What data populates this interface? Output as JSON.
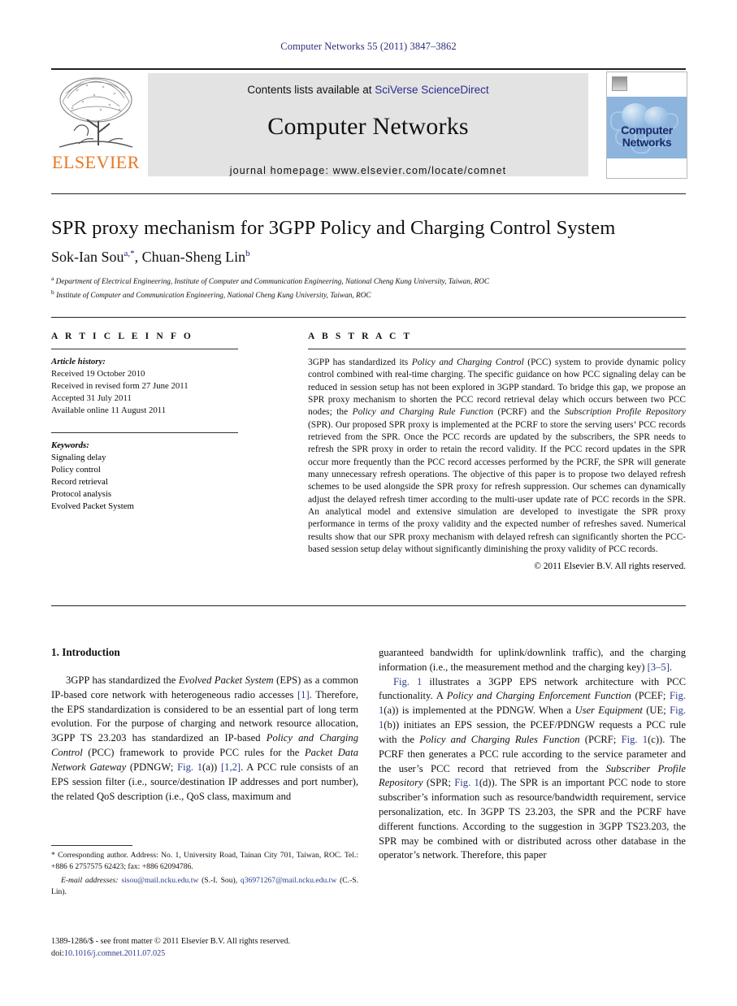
{
  "running_head": "Computer Networks 55 (2011) 3847–3862",
  "masthead": {
    "contents_prefix": "Contents lists available at ",
    "sciencedirect": "SciVerse ScienceDirect",
    "journal_title": "Computer Networks",
    "homepage": "journal homepage: www.elsevier.com/locate/comnet",
    "publisher_logo_text": "ELSEVIER",
    "cover_line1": "Computer",
    "cover_line2": "Networks"
  },
  "article": {
    "title": "SPR proxy mechanism for 3GPP Policy and Charging Control System",
    "authors_plain": "Sok-Ian Sou, Chuan-Sheng Lin",
    "author1": "Sok-Ian Sou",
    "author1_sup": "a,*",
    "author2": "Chuan-Sheng Lin",
    "author2_sup": "b",
    "affiliation_a_sup": "a",
    "affiliation_a": "Department of Electrical Engineering, Institute of Computer and Communication Engineering, National Cheng Kung University, Taiwan, ROC",
    "affiliation_b_sup": "b",
    "affiliation_b": "Institute of Computer and Communication Engineering, National Cheng Kung University, Taiwan, ROC"
  },
  "info": {
    "heading": "A R T I C L E    I N F O",
    "history_label": "Article history:",
    "history": [
      "Received 19 October 2010",
      "Received in revised form 27 June 2011",
      "Accepted 31 July 2011",
      "Available online 11 August 2011"
    ],
    "keywords_label": "Keywords:",
    "keywords": [
      "Signaling delay",
      "Policy control",
      "Record retrieval",
      "Protocol analysis",
      "Evolved Packet System"
    ]
  },
  "abstract": {
    "heading": "A B S T R A C T",
    "text_parts": [
      {
        "t": "3GPP has standardized its ",
        "i": false
      },
      {
        "t": "Policy and Charging Control",
        "i": true
      },
      {
        "t": " (PCC) system to provide dynamic policy control combined with real-time charging. The specific guidance on how PCC signaling delay can be reduced in session setup has not been explored in 3GPP standard. To bridge this gap, we propose an SPR proxy mechanism to shorten the PCC record retrieval delay which occurs between two PCC nodes; the ",
        "i": false
      },
      {
        "t": "Policy and Charging Rule Function",
        "i": true
      },
      {
        "t": " (PCRF) and the ",
        "i": false
      },
      {
        "t": "Subscription Profile Repository",
        "i": true
      },
      {
        "t": " (SPR). Our proposed SPR proxy is implemented at the PCRF to store the serving users’ PCC records retrieved from the SPR. Once the PCC records are updated by the subscribers, the SPR needs to refresh the SPR proxy in order to retain the record validity. If the PCC record updates in the SPR occur more frequently than the PCC record accesses performed by the PCRF, the SPR will generate many unnecessary refresh operations. The objective of this paper is to propose two delayed refresh schemes to be used alongside the SPR proxy for refresh suppression. Our schemes can dynamically adjust the delayed refresh timer according to the multi-user update rate of PCC records in the SPR. An analytical model and extensive simulation are developed to investigate the SPR proxy performance in terms of the proxy validity and the expected number of refreshes saved. Numerical results show that our SPR proxy mechanism with delayed refresh can significantly shorten the PCC-based session setup delay without significantly diminishing the proxy validity of PCC records.",
        "i": false
      }
    ],
    "copyright": "© 2011 Elsevier B.V. All rights reserved."
  },
  "body": {
    "section1_heading": "1. Introduction",
    "left_paragraphs": [
      [
        {
          "t": "3GPP has standardized the ",
          "i": false
        },
        {
          "t": "Evolved Packet System",
          "i": true
        },
        {
          "t": " (EPS) as a common IP-based core network with heterogeneous radio accesses ",
          "i": false
        },
        {
          "t": "[1]",
          "i": false,
          "ref": true
        },
        {
          "t": ". Therefore, the EPS standardization is considered to be an essential part of long term evolution. For the purpose of charging and network resource allocation, 3GPP TS 23.203 has standardized an IP-based ",
          "i": false
        },
        {
          "t": "Policy and Charging Control",
          "i": true
        },
        {
          "t": " (PCC) framework to provide PCC rules for the ",
          "i": false
        },
        {
          "t": "Packet Data Network Gateway",
          "i": true
        },
        {
          "t": " (PDNGW; ",
          "i": false
        },
        {
          "t": "Fig. 1",
          "i": false,
          "ref": true
        },
        {
          "t": "(a)) ",
          "i": false
        },
        {
          "t": "[1,2]",
          "i": false,
          "ref": true
        },
        {
          "t": ". A PCC rule consists of an EPS session filter (i.e., source/destination IP addresses and port number), the related QoS description (i.e., QoS class, maximum and",
          "i": false
        }
      ]
    ],
    "right_paragraphs": [
      [
        {
          "t": "guaranteed bandwidth for uplink/downlink traffic), and the charging information (i.e., the measurement method and the charging key) ",
          "i": false
        },
        {
          "t": "[3–5]",
          "i": false,
          "ref": true
        },
        {
          "t": ".",
          "i": false
        }
      ],
      [
        {
          "t": "Fig. 1",
          "i": false,
          "ref": true
        },
        {
          "t": " illustrates a 3GPP EPS network architecture with PCC functionality. A ",
          "i": false
        },
        {
          "t": "Policy and Charging Enforcement Function",
          "i": true
        },
        {
          "t": " (PCEF; ",
          "i": false
        },
        {
          "t": "Fig. 1",
          "i": false,
          "ref": true
        },
        {
          "t": "(a)) is implemented at the PDNGW. When a ",
          "i": false
        },
        {
          "t": "User Equipment",
          "i": true
        },
        {
          "t": " (UE; ",
          "i": false
        },
        {
          "t": "Fig. 1",
          "i": false,
          "ref": true
        },
        {
          "t": "(b)) initiates an EPS session, the PCEF/PDNGW requests a PCC rule with the ",
          "i": false
        },
        {
          "t": "Policy and Charging Rules Function",
          "i": true
        },
        {
          "t": " (PCRF; ",
          "i": false
        },
        {
          "t": "Fig. 1",
          "i": false,
          "ref": true
        },
        {
          "t": "(c)). The PCRF then generates a PCC rule according to the service parameter and the user’s PCC record that retrieved from the ",
          "i": false
        },
        {
          "t": "Subscriber Profile Repository",
          "i": true
        },
        {
          "t": " (SPR; ",
          "i": false
        },
        {
          "t": "Fig. 1",
          "i": false,
          "ref": true
        },
        {
          "t": "(d)). The SPR is an important PCC node to store subscriber’s information such as resource/bandwidth requirement, service personalization, etc. In 3GPP TS 23.203, the SPR and the PCRF have different functions. According to the suggestion in 3GPP TS23.203, the SPR may be combined with or distributed across other database in the operator’s network. Therefore, this paper",
          "i": false
        }
      ]
    ]
  },
  "footnotes": {
    "corresponding": "* Corresponding author. Address: No. 1, University Road, Tainan City 701, Taiwan, ROC. Tel.: +886 6 2757575 62423; fax: +886 62094786.",
    "email_label": "E-mail addresses:",
    "email1": "sisou@mail.ncku.edu.tw",
    "email1_owner": "(S.-I. Sou)",
    "email2": "q36971267@mail.ncku.edu.tw",
    "email2_owner": "(C.-S. Lin)."
  },
  "imprint": {
    "issn_line": "1389-1286/$ - see front matter © 2011 Elsevier B.V. All rights reserved.",
    "doi_label": "doi:",
    "doi": "10.1016/j.comnet.2011.07.025"
  },
  "colors": {
    "link": "#2b3e8c",
    "running_head": "#2b2b77",
    "elsevier_orange": "#e87722",
    "band_grey": "#e3e3e3",
    "cover_blue": "#8cb4dc"
  }
}
